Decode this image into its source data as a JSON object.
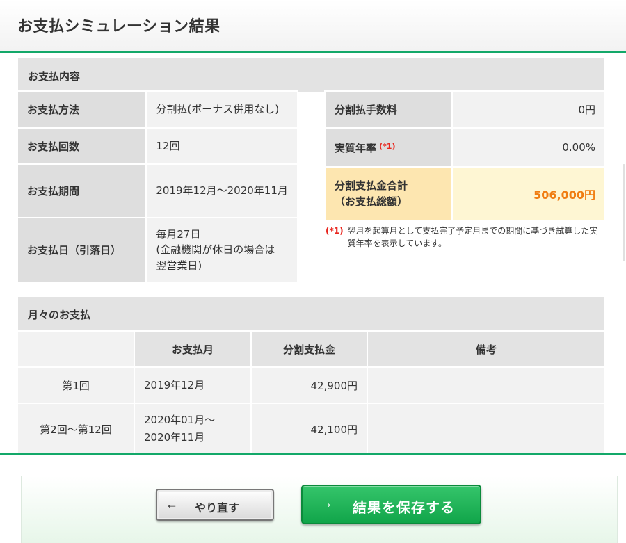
{
  "page_title": "お支払シミュレーション結果",
  "payment_details": {
    "section_title": "お支払内容",
    "left_rows": [
      {
        "label": "お支払方法",
        "value": "分割払(ボーナス併用なし)"
      },
      {
        "label": "お支払回数",
        "value": "12回"
      },
      {
        "label": "お支払期間",
        "value": "2019年12月～2020年11月"
      },
      {
        "label": "お支払日（引落日）",
        "value_lines": [
          "毎月27日",
          "(金融機関が休日の場合は",
          "翌営業日)"
        ]
      }
    ],
    "right_rows": {
      "fee": {
        "label": "分割払手数料",
        "value": "0円"
      },
      "rate": {
        "label": "実質年率",
        "mark": "(*1)",
        "value": "0.00%"
      },
      "total": {
        "label_lines": [
          "分割支払金合計",
          "（お支払総額）"
        ],
        "value": "506,000円"
      }
    },
    "note": {
      "mark": "(*1)",
      "text": "翌月を起算月として支払完了予定月までの期間に基づき試算した実質年率を表示しています。"
    }
  },
  "monthly": {
    "section_title": "月々のお支払",
    "columns": [
      "",
      "お支払月",
      "分割支払金",
      "備考"
    ],
    "rows": [
      {
        "no": "第1回",
        "month_lines": [
          "2019年12月"
        ],
        "amount": "42,900円",
        "remarks": ""
      },
      {
        "no": "第2回～第12回",
        "month_lines": [
          "2020年01月～",
          "2020年11月"
        ],
        "amount": "42,100円",
        "remarks": ""
      }
    ]
  },
  "buttons": {
    "back": {
      "arrow": "←",
      "label": "やり直す"
    },
    "save": {
      "arrow": "→",
      "label": "結果を保存する"
    }
  },
  "colors": {
    "accent_green": "#13a869",
    "total_orange": "#f07d12",
    "note_red": "#e8261e",
    "total_bg": "#fef6d3"
  }
}
